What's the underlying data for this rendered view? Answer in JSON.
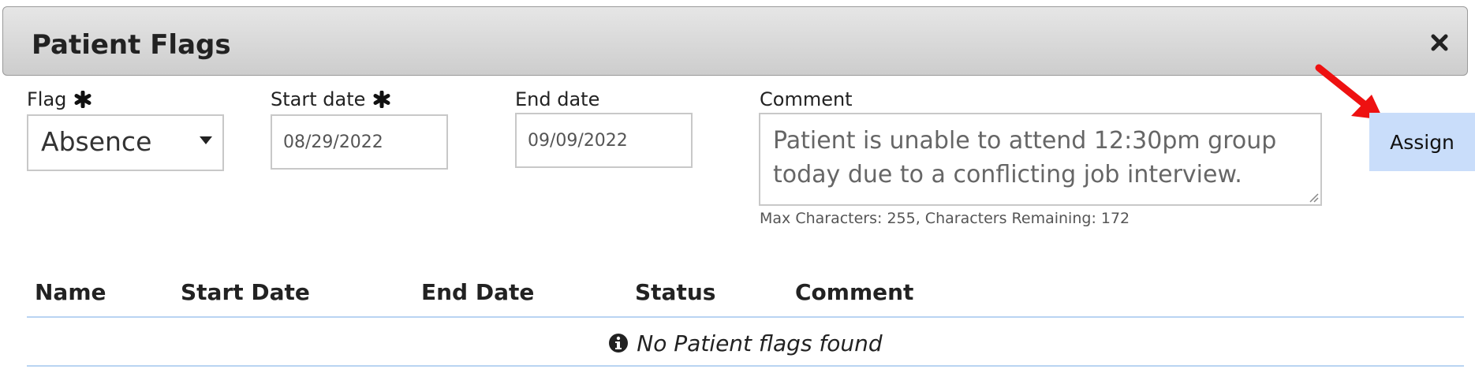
{
  "dialog": {
    "title": "Patient Flags"
  },
  "form": {
    "flag_label": "Flag",
    "flag_value": "Absence",
    "start_label": "Start date",
    "start_value": "08/29/2022",
    "end_label": "End date",
    "end_value": "09/09/2022",
    "comment_label": "Comment",
    "comment_value": "Patient is unable to attend 12:30pm group today due to a conflicting job interview.",
    "counter": "Max Characters: 255, Characters Remaining: 172",
    "assign_label": "Assign"
  },
  "table": {
    "headers": [
      "Name",
      "Start Date",
      "End Date",
      "Status",
      "Comment"
    ],
    "empty_message": "No Patient flags found"
  },
  "colors": {
    "assign_bg": "#c9ddfa",
    "annotation_arrow": "#ee1111",
    "table_rule": "#b9d4f2"
  },
  "icons": [
    "close-icon",
    "required-asterisk-icon",
    "dropdown-caret-icon",
    "resize-grip-icon",
    "info-icon",
    "annotation-arrow"
  ]
}
